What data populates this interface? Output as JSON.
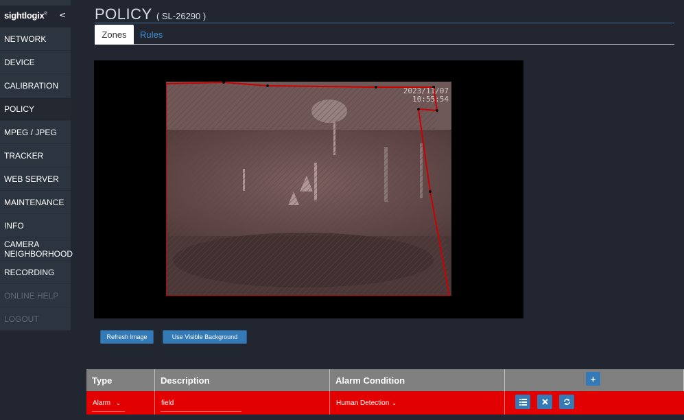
{
  "sidebar": {
    "brand": "sightlogix",
    "brand_mark": "®",
    "collapse_label": "<",
    "items": [
      {
        "label": "NETWORK"
      },
      {
        "label": "DEVICE"
      },
      {
        "label": "CALIBRATION"
      },
      {
        "label": "POLICY"
      },
      {
        "label": "MPEG / JPEG"
      },
      {
        "label": "TRACKER"
      },
      {
        "label": "WEB SERVER"
      },
      {
        "label": "MAINTENANCE"
      },
      {
        "label": "INFO"
      },
      {
        "label": "CAMERA NEIGHBORHOOD"
      },
      {
        "label": "RECORDING"
      },
      {
        "label": "ONLINE HELP"
      },
      {
        "label": "LOGOUT"
      }
    ]
  },
  "header": {
    "title": "POLICY",
    "device": "( SL-26290 )"
  },
  "tabs": [
    {
      "label": "Zones"
    },
    {
      "label": "Rules"
    }
  ],
  "camera": {
    "timestamp_date": "2023/11/07",
    "timestamp_time": "10:55:54",
    "zone_color": "#cc0000"
  },
  "buttons": {
    "refresh": "Refresh Image",
    "visible_bg": "Use Visible Background"
  },
  "table": {
    "headers": [
      "Type",
      "Description",
      "Alarm Condition"
    ],
    "add_label": "+",
    "rows": [
      {
        "type": "Alarm",
        "description": "field",
        "alarm_condition": "Human Detection",
        "row_color": "#e30000"
      }
    ]
  }
}
